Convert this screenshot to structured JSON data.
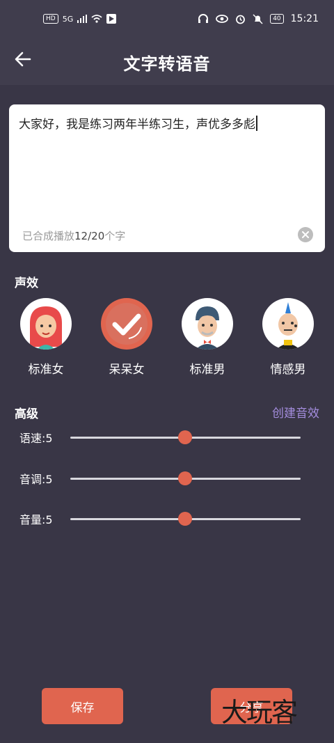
{
  "status": {
    "left": [
      "HD",
      "5G"
    ],
    "time": "15:21",
    "battery": "40"
  },
  "header": {
    "title": "文字转语音"
  },
  "editor": {
    "text": "大家好，我是练习两年半练习生，声优多多彪",
    "counter_prefix": "已合成播放",
    "counter_value": "12/20",
    "counter_suffix": "个字"
  },
  "effects": {
    "label": "声效",
    "voices": [
      {
        "label": "标准女",
        "icon": "girl-avatar-icon",
        "selected": false
      },
      {
        "label": "呆呆女",
        "icon": "checkmark-icon",
        "selected": true
      },
      {
        "label": "标准男",
        "icon": "man-avatar-icon",
        "selected": false
      },
      {
        "label": "情感男",
        "icon": "punk-avatar-icon",
        "selected": false
      }
    ]
  },
  "advanced": {
    "label": "高级",
    "create_link": "创建音效",
    "sliders": [
      {
        "label": "语速:5",
        "value": 5,
        "max": 10
      },
      {
        "label": "音调:5",
        "value": 5,
        "max": 10
      },
      {
        "label": "音量:5",
        "value": 5,
        "max": 10
      }
    ]
  },
  "footer": {
    "save_label": "保存",
    "share_label": "分享"
  },
  "watermark": "大玩客",
  "colors": {
    "accent": "#e0654f",
    "background": "#393646",
    "link": "#a48dde"
  }
}
